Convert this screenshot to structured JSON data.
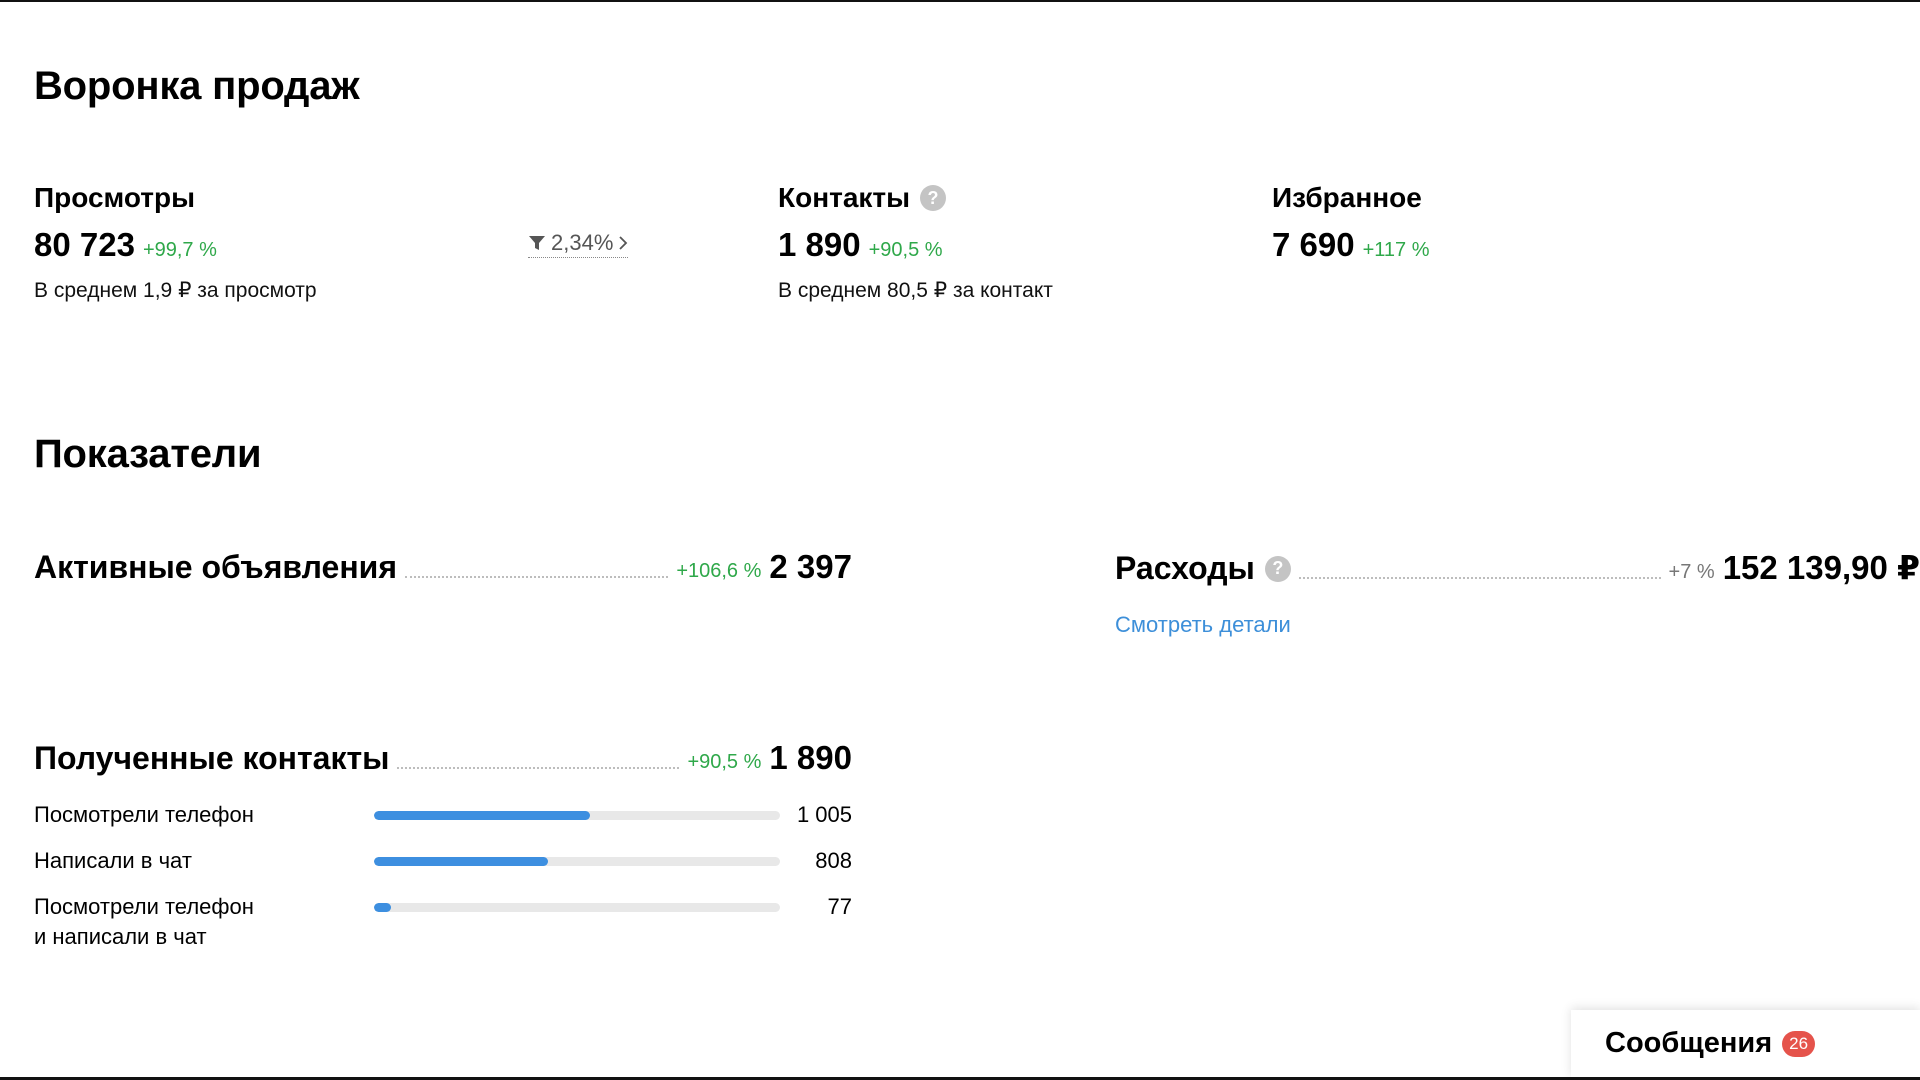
{
  "funnel": {
    "title": "Воронка продаж",
    "views": {
      "label": "Просмотры",
      "value": "80 723",
      "delta": "+99,7 %",
      "sub": "В среднем 1,9 ₽ за просмотр"
    },
    "conversion": {
      "value": "2,34%"
    },
    "contacts": {
      "label": "Контакты",
      "help": "?",
      "value": "1 890",
      "delta": "+90,5 %",
      "sub": "В среднем 80,5 ₽ за контакт"
    },
    "favorites": {
      "label": "Избранное",
      "value": "7 690",
      "delta": "+117 %"
    }
  },
  "metrics": {
    "title": "Показатели",
    "active_ads": {
      "label": "Активные объявления",
      "delta": "+106,6 %",
      "value": "2 397"
    },
    "expenses": {
      "label": "Расходы",
      "help": "?",
      "delta": "+7 %",
      "value": "152 139,90 ₽",
      "details_link": "Смотреть детали"
    },
    "received_contacts": {
      "label": "Полученные контакты",
      "delta": "+90,5 %",
      "value": "1 890",
      "items": [
        {
          "label": "Посмотрели телефон",
          "value": "1 005",
          "share": 0.532
        },
        {
          "label": "Написали в чат",
          "value": "808",
          "share": 0.428
        },
        {
          "label_line1": "Посмотрели телефон",
          "label_line2": "и написали в чат",
          "value": "77",
          "share": 0.041
        }
      ]
    }
  },
  "messages": {
    "label": "Сообщения",
    "count": "26"
  },
  "colors": {
    "positive": "#2fa84a",
    "bar": "#3d8fe0",
    "link": "#3d8fd9",
    "badge": "#e5534b"
  }
}
